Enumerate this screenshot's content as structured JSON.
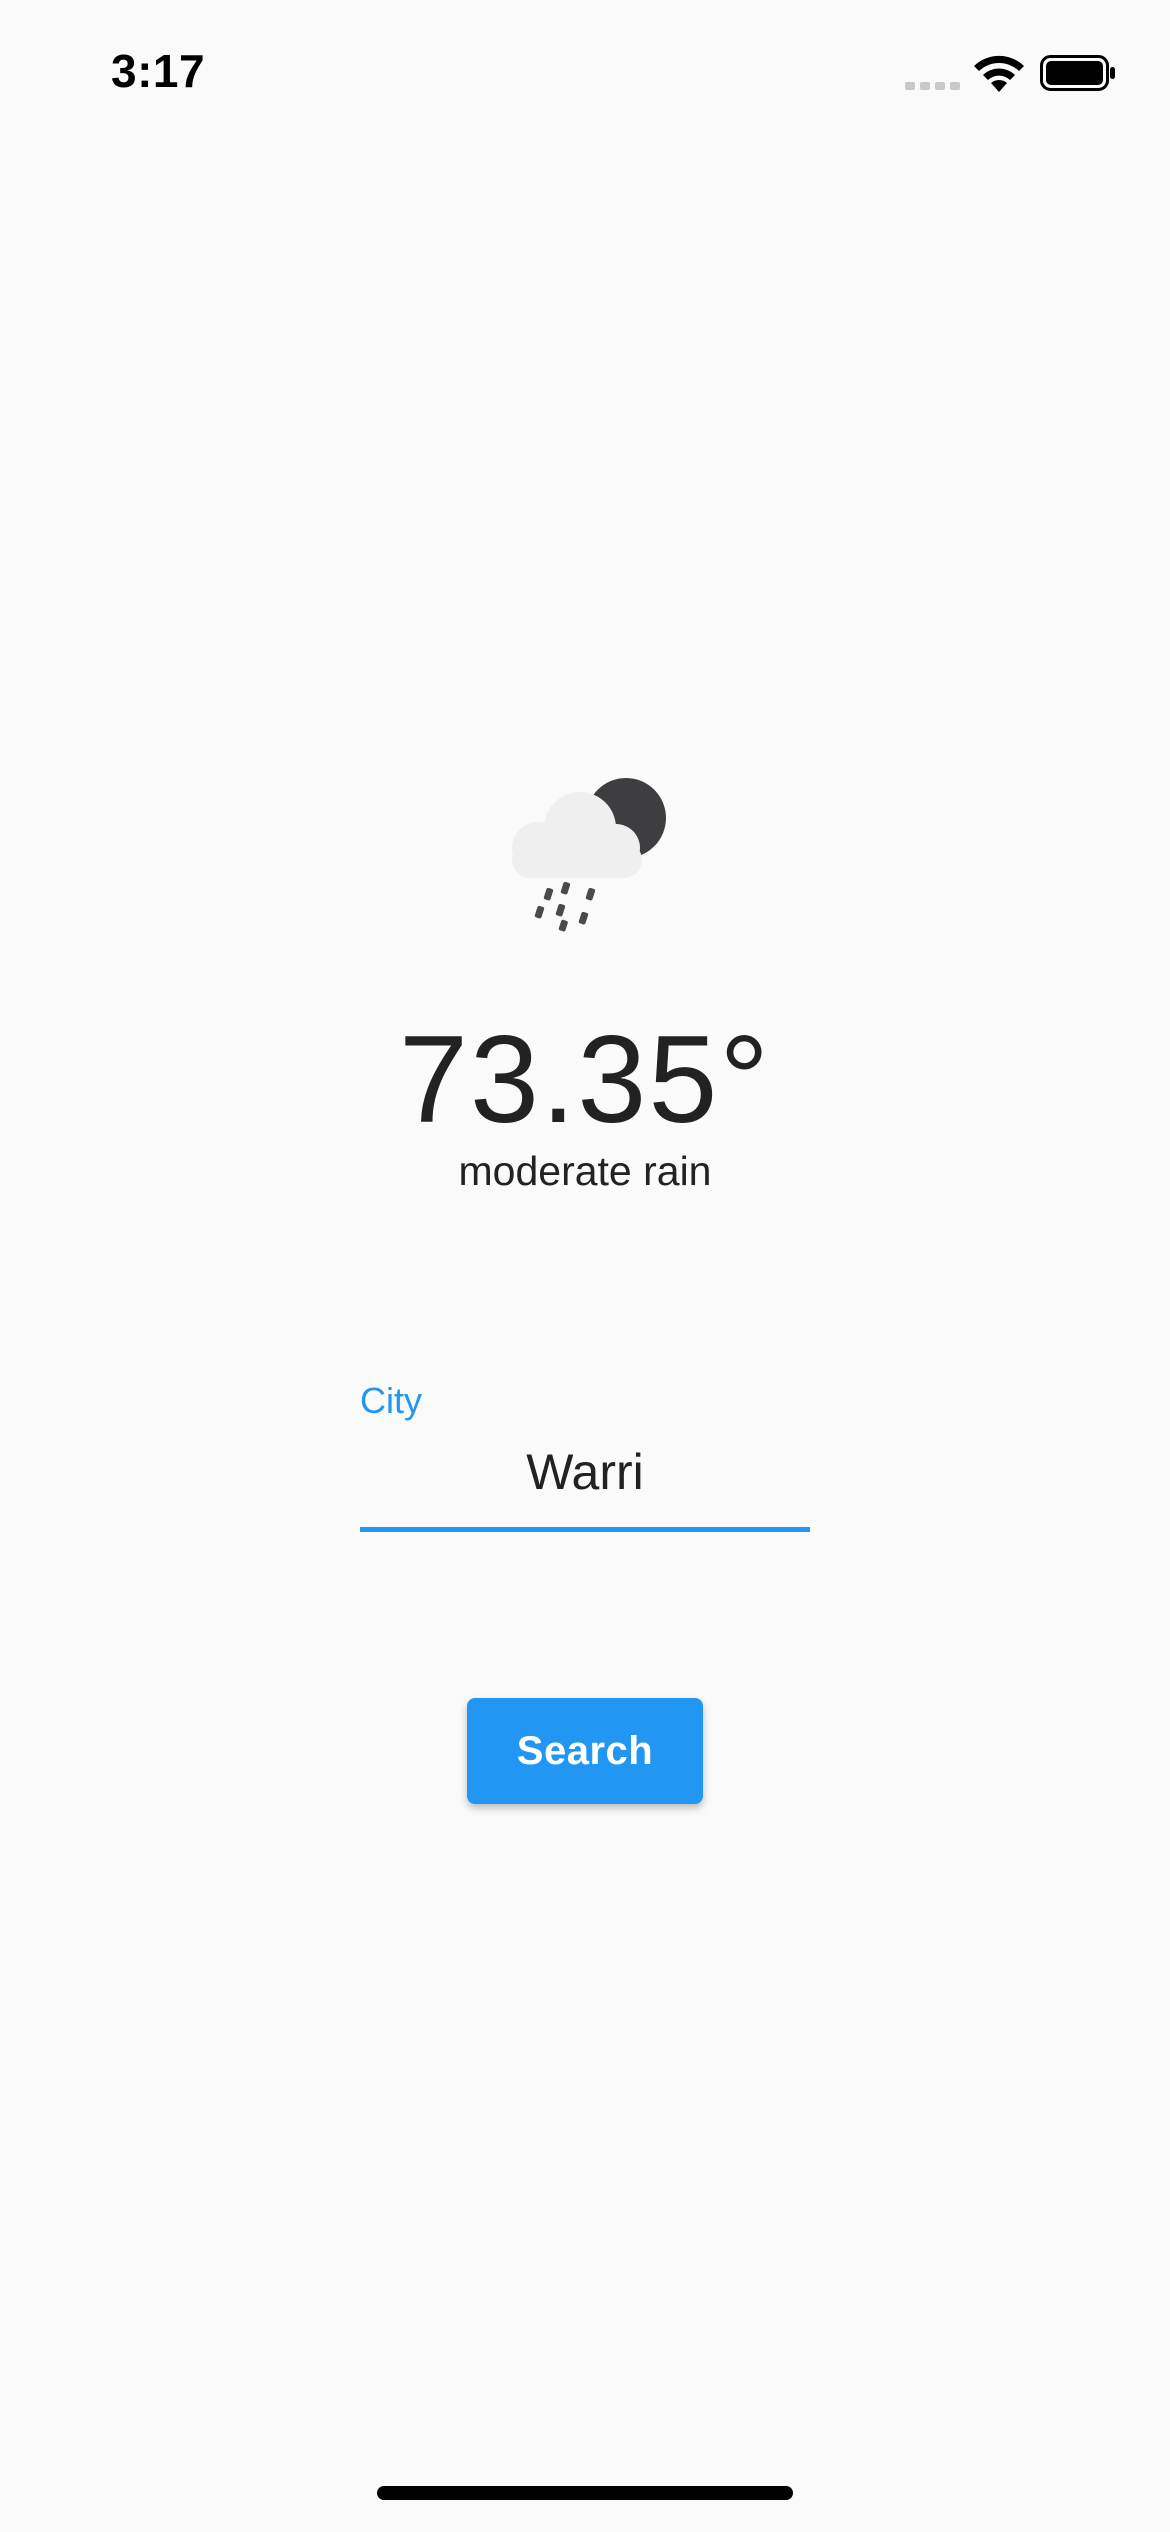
{
  "status_bar": {
    "time": "3:17"
  },
  "weather": {
    "icon": "cloud-rain-moon-icon",
    "temperature": "73.35°",
    "description": "moderate rain"
  },
  "city_field": {
    "label": "City",
    "value": "Warri"
  },
  "search_button": {
    "label": "Search"
  },
  "colors": {
    "accent": "#2196f3",
    "background": "#fafafa",
    "text": "#222222"
  }
}
